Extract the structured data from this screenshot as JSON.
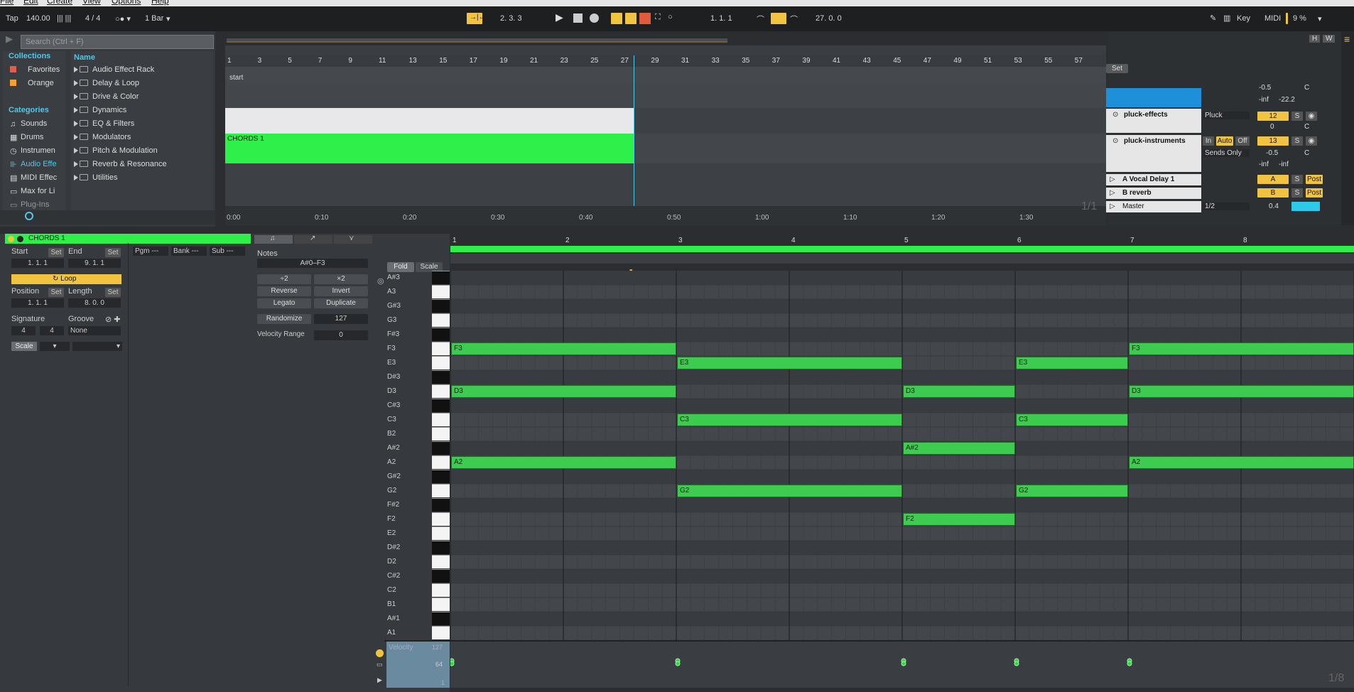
{
  "menu": {
    "items": [
      "File",
      "Edit",
      "Create",
      "View",
      "Options",
      "Help"
    ]
  },
  "control": {
    "tap": "Tap",
    "tempo": "140.00",
    "signature": "4 / 4",
    "quantize": "1 Bar",
    "position": "2.  3.  3",
    "loop_start": "1.  1.  1",
    "loop_length": "27.  0.  0",
    "key_label": "Key",
    "midi_label": "MIDI",
    "cpu": "9 %"
  },
  "browser": {
    "search_placeholder": "Search (Ctrl + F)",
    "collections_header": "Collections",
    "collections": [
      {
        "label": "Favorites",
        "color": "#e25d4b"
      },
      {
        "label": "Orange",
        "color": "#f0a036"
      }
    ],
    "categories_header": "Categories",
    "categories": [
      "Sounds",
      "Drums",
      "Instrumen",
      "Audio Effe",
      "MIDI Effec",
      "Max for Li",
      "Plug-Ins"
    ],
    "name_header": "Name",
    "items": [
      "Audio Effect Rack",
      "Delay & Loop",
      "Drive & Color",
      "Dynamics",
      "EQ & Filters",
      "Modulators",
      "Pitch & Modulation",
      "Reverb & Resonance",
      "Utilities"
    ]
  },
  "arrangement": {
    "bar_numbers": [
      "1",
      "3",
      "5",
      "7",
      "9",
      "11",
      "13",
      "15",
      "17",
      "19",
      "21",
      "23",
      "25",
      "27",
      "29",
      "31",
      "33",
      "35",
      "37",
      "39",
      "41",
      "43",
      "45",
      "47",
      "49",
      "51",
      "53",
      "55",
      "57"
    ],
    "locator": "start",
    "clip_name": "CHORDS 1",
    "time_labels": [
      "0:00",
      "0:10",
      "0:20",
      "0:30",
      "0:40",
      "0:50",
      "1:00",
      "1:10",
      "1:20",
      "1:30"
    ],
    "page": "1/1",
    "set_label": "Set",
    "h_label": "H",
    "w_label": "W"
  },
  "mixer": {
    "top_values": [
      "-0.5",
      "C",
      "-inf",
      "-22.2"
    ],
    "tracks": [
      {
        "name": "pluck-effects",
        "routing": "Pluck",
        "number": "12",
        "pan": "0",
        "panc": "C"
      },
      {
        "name": "pluck-instruments",
        "in": "In",
        "auto": "Auto",
        "off": "Off",
        "routing": "Sends Only",
        "number": "13",
        "vol": "-0.5",
        "panc": "C",
        "inf1": "-inf",
        "inf2": "-inf"
      }
    ],
    "returns": [
      {
        "name": "A Vocal Delay 1",
        "letter": "A",
        "post": "Post"
      },
      {
        "name": "B reverb",
        "letter": "B",
        "post": "Post"
      }
    ],
    "master": {
      "name": "Master",
      "ratio": "1/2",
      "value": "0.4"
    },
    "solo": "S"
  },
  "clip": {
    "title": "CHORDS 1",
    "start_label": "Start",
    "end_label": "End",
    "set": "Set",
    "start": "1.  1.  1",
    "end": "9.  1.  1",
    "loop": "Loop",
    "position_label": "Position",
    "length_label": "Length",
    "position": "1.  1.  1",
    "length": "8.  0.  0",
    "signature_label": "Signature",
    "groove_label": "Groove",
    "sig_num": "4",
    "sig_den": "4",
    "groove": "None",
    "scale": "Scale",
    "pgm": "Pgm ---",
    "bank": "Bank ---",
    "sub": "Sub ---"
  },
  "notes_panel": {
    "header": "Notes",
    "range": "A#0–F3",
    "plus2": "÷2",
    "times2": "×2",
    "reverse": "Reverse",
    "invert": "Invert",
    "legato": "Legato",
    "duplicate": "Duplicate",
    "randomize": "Randomize",
    "rand_val": "127",
    "vel_range_label": "Velocity Range",
    "vel_range": "0"
  },
  "editor": {
    "fold": "Fold",
    "scale": "Scale",
    "beats": [
      "1",
      "2",
      "3",
      "4",
      "5",
      "6",
      "7",
      "8"
    ],
    "keys": [
      "A#3",
      "A3",
      "G#3",
      "G3",
      "F#3",
      "F3",
      "E3",
      "D#3",
      "D3",
      "C#3",
      "C3",
      "B2",
      "A#2",
      "A2",
      "G#2",
      "G2",
      "F#2",
      "F2",
      "E2",
      "D#2",
      "D2",
      "C#2",
      "C2",
      "B1",
      "A#1",
      "A1"
    ],
    "notes": [
      {
        "pitch": "F3",
        "start": 0,
        "length": 2
      },
      {
        "pitch": "D3",
        "start": 0,
        "length": 2
      },
      {
        "pitch": "A2",
        "start": 0,
        "length": 2
      },
      {
        "pitch": "E3",
        "start": 2,
        "length": 2
      },
      {
        "pitch": "C3",
        "start": 2,
        "length": 2
      },
      {
        "pitch": "G2",
        "start": 2,
        "length": 2
      },
      {
        "pitch": "D3",
        "start": 4,
        "length": 1
      },
      {
        "pitch": "A#2",
        "start": 4,
        "length": 1
      },
      {
        "pitch": "F2",
        "start": 4,
        "length": 1
      },
      {
        "pitch": "E3",
        "start": 5,
        "length": 1
      },
      {
        "pitch": "C3",
        "start": 5,
        "length": 1
      },
      {
        "pitch": "G2",
        "start": 5,
        "length": 1
      },
      {
        "pitch": "F3",
        "start": 6,
        "length": 2
      },
      {
        "pitch": "D3",
        "start": 6,
        "length": 2
      },
      {
        "pitch": "A2",
        "start": 6,
        "length": 2
      }
    ],
    "velocity_label": "Velocity",
    "vel_max": "127",
    "vel_mid": "64",
    "vel_min": "1",
    "grid": "1/8"
  },
  "colors": {
    "green": "#3dcc4f",
    "yellow": "#f0c341",
    "cyan": "#4ec9ea"
  }
}
